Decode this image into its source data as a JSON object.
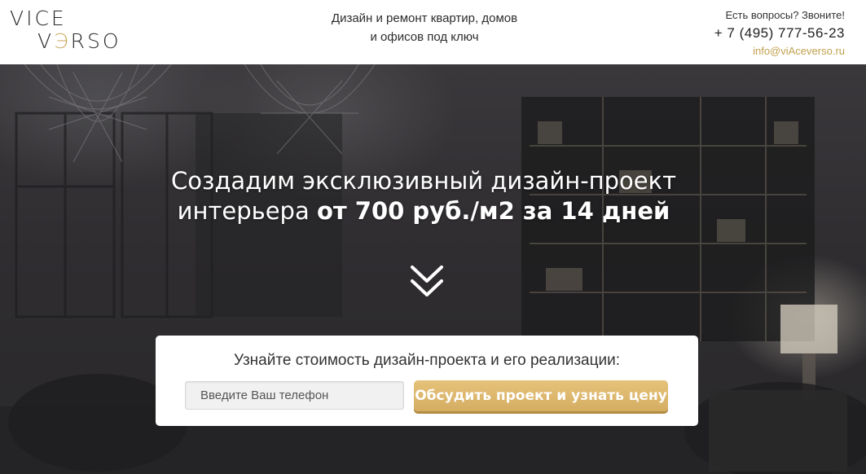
{
  "brand": {
    "logo_line1": "VICE",
    "logo_line2_a": "V",
    "logo_line2_b": "Э",
    "logo_line2_c": "RSO",
    "accent_color": "#c9a65a"
  },
  "header": {
    "tagline_line1": "Дизайн и ремонт квартир, домов",
    "tagline_line2": "и офисов под ключ",
    "contact_question": "Есть вопросы? Звоните!",
    "phone": "+ 7 (495) 777-56-23",
    "email": "info@viAceverso.ru"
  },
  "hero": {
    "headline_line1": "Создадим эксклюзивный дизайн-проект",
    "headline_line2_plain": "интерьера ",
    "headline_line2_bold": "от 700 руб./м2 за 14 дней",
    "scroll_icon": "double-chevron-down-icon"
  },
  "form": {
    "title": "Узнайте стоимость дизайн-проекта и его реализации:",
    "phone_placeholder": "Введите Ваш телефон",
    "phone_value": "",
    "submit_label": "Обсудить проект и узнать цену",
    "button_color": "#d9b56b"
  }
}
